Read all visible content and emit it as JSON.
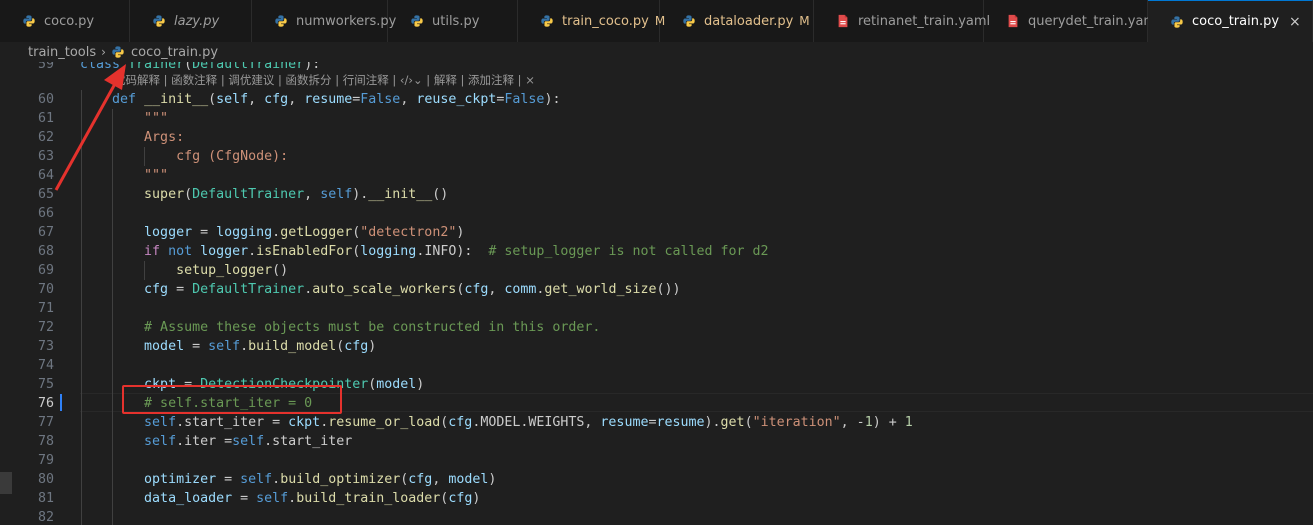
{
  "tabs": [
    {
      "label": "coco.py",
      "icon": "python-icon",
      "italic": false,
      "modified": false,
      "active": false
    },
    {
      "label": "lazy.py",
      "icon": "python-icon",
      "italic": true,
      "modified": false,
      "active": false
    },
    {
      "label": "numworkers.py",
      "icon": "python-icon",
      "italic": false,
      "modified": false,
      "active": false
    },
    {
      "label": "utils.py",
      "icon": "python-icon",
      "italic": false,
      "modified": false,
      "active": false
    },
    {
      "label": "train_coco.py",
      "icon": "python-icon",
      "italic": false,
      "modified": true,
      "active": false
    },
    {
      "label": "dataloader.py",
      "icon": "python-icon",
      "italic": false,
      "modified": true,
      "active": false
    },
    {
      "label": "retinanet_train.yaml",
      "icon": "yaml-icon",
      "italic": false,
      "modified": false,
      "active": false
    },
    {
      "label": "querydet_train.yaml",
      "icon": "yaml-icon",
      "italic": false,
      "modified": false,
      "active": false
    },
    {
      "label": "coco_train.py",
      "icon": "python-icon",
      "italic": false,
      "modified": false,
      "active": true
    }
  ],
  "modified_flag": "M",
  "close_glyph": "×",
  "breadcrumb": {
    "folder": "train_tools",
    "separator": "›",
    "file": "coco_train.py"
  },
  "codelens": "代码解释 | 函数注释 | 调优建议 | 函数拆分 | 行间注释 | ‹/›⌄ | 解释 | 添加注释 | ×",
  "current_line": "76",
  "lines": [
    {
      "n": "59",
      "tokens": [
        [
          "kw",
          "class "
        ],
        [
          "cls",
          "Trainer"
        ],
        [
          "",
          "("
        ],
        [
          "cls",
          "DefaultTrainer"
        ],
        [
          "",
          "):"
        ]
      ]
    },
    {
      "n": "60",
      "tokens": [
        [
          "",
          "    "
        ],
        [
          "kw",
          "def "
        ],
        [
          "fn",
          "__init__"
        ],
        [
          "",
          "("
        ],
        [
          "pr",
          "self"
        ],
        [
          "",
          ", "
        ],
        [
          "pr",
          "cfg"
        ],
        [
          "",
          ", "
        ],
        [
          "pr",
          "resume"
        ],
        [
          "",
          "="
        ],
        [
          "kw",
          "False"
        ],
        [
          "",
          ", "
        ],
        [
          "pr",
          "reuse_ckpt"
        ],
        [
          "",
          "="
        ],
        [
          "kw",
          "False"
        ],
        [
          "",
          "):"
        ]
      ]
    },
    {
      "n": "61",
      "tokens": [
        [
          "",
          "        "
        ],
        [
          "str",
          "\"\"\""
        ]
      ]
    },
    {
      "n": "62",
      "tokens": [
        [
          "",
          "        "
        ],
        [
          "str",
          "Args:"
        ]
      ]
    },
    {
      "n": "63",
      "tokens": [
        [
          "",
          "            "
        ],
        [
          "str",
          "cfg (CfgNode):"
        ]
      ]
    },
    {
      "n": "64",
      "tokens": [
        [
          "",
          "        "
        ],
        [
          "str",
          "\"\"\""
        ]
      ]
    },
    {
      "n": "65",
      "tokens": [
        [
          "",
          "        "
        ],
        [
          "fn",
          "super"
        ],
        [
          "",
          "("
        ],
        [
          "cls",
          "DefaultTrainer"
        ],
        [
          "",
          ", "
        ],
        [
          "kw",
          "self"
        ],
        [
          "",
          ")."
        ],
        [
          "fn",
          "__init__"
        ],
        [
          "",
          "()"
        ]
      ]
    },
    {
      "n": "66",
      "tokens": []
    },
    {
      "n": "67",
      "tokens": [
        [
          "",
          "        "
        ],
        [
          "pr",
          "logger"
        ],
        [
          "",
          " = "
        ],
        [
          "pr",
          "logging"
        ],
        [
          "",
          "."
        ],
        [
          "fn",
          "getLogger"
        ],
        [
          "",
          "("
        ],
        [
          "str",
          "\"detectron2\""
        ],
        [
          "",
          ")"
        ]
      ]
    },
    {
      "n": "68",
      "tokens": [
        [
          "",
          "        "
        ],
        [
          "ctl",
          "if "
        ],
        [
          "kw",
          "not "
        ],
        [
          "pr",
          "logger"
        ],
        [
          "",
          "."
        ],
        [
          "fn",
          "isEnabledFor"
        ],
        [
          "",
          "("
        ],
        [
          "pr",
          "logging"
        ],
        [
          "",
          ".INFO):  "
        ],
        [
          "cmt",
          "# setup_logger is not called for d2"
        ]
      ]
    },
    {
      "n": "69",
      "tokens": [
        [
          "",
          "            "
        ],
        [
          "fn",
          "setup_logger"
        ],
        [
          "",
          "()"
        ]
      ]
    },
    {
      "n": "70",
      "tokens": [
        [
          "",
          "        "
        ],
        [
          "pr",
          "cfg"
        ],
        [
          "",
          " = "
        ],
        [
          "cls",
          "DefaultTrainer"
        ],
        [
          "",
          "."
        ],
        [
          "fn",
          "auto_scale_workers"
        ],
        [
          "",
          "("
        ],
        [
          "pr",
          "cfg"
        ],
        [
          "",
          ", "
        ],
        [
          "pr",
          "comm"
        ],
        [
          "",
          "."
        ],
        [
          "fn",
          "get_world_size"
        ],
        [
          "",
          "())"
        ]
      ]
    },
    {
      "n": "71",
      "tokens": []
    },
    {
      "n": "72",
      "tokens": [
        [
          "",
          "        "
        ],
        [
          "cmt",
          "# Assume these objects must be constructed in this order."
        ]
      ]
    },
    {
      "n": "73",
      "tokens": [
        [
          "",
          "        "
        ],
        [
          "pr",
          "model"
        ],
        [
          "",
          " = "
        ],
        [
          "kw",
          "self"
        ],
        [
          "",
          "."
        ],
        [
          "fn",
          "build_model"
        ],
        [
          "",
          "("
        ],
        [
          "pr",
          "cfg"
        ],
        [
          "",
          ")"
        ]
      ]
    },
    {
      "n": "74",
      "tokens": []
    },
    {
      "n": "75",
      "tokens": [
        [
          "",
          "        "
        ],
        [
          "pr",
          "ckpt"
        ],
        [
          "",
          " = "
        ],
        [
          "cls",
          "DetectionCheckpointer"
        ],
        [
          "",
          "("
        ],
        [
          "pr",
          "model"
        ],
        [
          "",
          ")"
        ]
      ]
    },
    {
      "n": "76",
      "tokens": [
        [
          "",
          "        "
        ],
        [
          "cmt",
          "# self.start_iter = 0"
        ]
      ]
    },
    {
      "n": "77",
      "tokens": [
        [
          "",
          "        "
        ],
        [
          "kw",
          "self"
        ],
        [
          "",
          ".start_iter = "
        ],
        [
          "pr",
          "ckpt"
        ],
        [
          "",
          "."
        ],
        [
          "fn",
          "resume_or_load"
        ],
        [
          "",
          "("
        ],
        [
          "pr",
          "cfg"
        ],
        [
          "",
          ".MODEL.WEIGHTS, "
        ],
        [
          "pr",
          "resume"
        ],
        [
          "",
          "="
        ],
        [
          "pr",
          "resume"
        ],
        [
          "",
          ")."
        ],
        [
          "fn",
          "get"
        ],
        [
          "",
          "("
        ],
        [
          "str",
          "\"iteration\""
        ],
        [
          "",
          ", -"
        ],
        [
          "num",
          "1"
        ],
        [
          "",
          ") + "
        ],
        [
          "num",
          "1"
        ]
      ]
    },
    {
      "n": "78",
      "tokens": [
        [
          "",
          "        "
        ],
        [
          "kw",
          "self"
        ],
        [
          "",
          ".iter ="
        ],
        [
          "kw",
          "self"
        ],
        [
          "",
          ".start_iter"
        ]
      ]
    },
    {
      "n": "79",
      "tokens": []
    },
    {
      "n": "80",
      "tokens": [
        [
          "",
          "        "
        ],
        [
          "pr",
          "optimizer"
        ],
        [
          "",
          " = "
        ],
        [
          "kw",
          "self"
        ],
        [
          "",
          "."
        ],
        [
          "fn",
          "build_optimizer"
        ],
        [
          "",
          "("
        ],
        [
          "pr",
          "cfg"
        ],
        [
          "",
          ", "
        ],
        [
          "pr",
          "model"
        ],
        [
          "",
          ")"
        ]
      ]
    },
    {
      "n": "81",
      "tokens": [
        [
          "",
          "        "
        ],
        [
          "pr",
          "data_loader"
        ],
        [
          "",
          " = "
        ],
        [
          "kw",
          "self"
        ],
        [
          "",
          "."
        ],
        [
          "fn",
          "build_train_loader"
        ],
        [
          "",
          "("
        ],
        [
          "pr",
          "cfg"
        ],
        [
          "",
          ")"
        ]
      ]
    },
    {
      "n": "82",
      "tokens": []
    }
  ],
  "colors": {
    "accent": "#0078d4",
    "annotation_red": "#e5322d",
    "python_icon_blue": "#3572a5",
    "python_icon_yellow": "#f7c948",
    "yaml_icon": "#e04b4b"
  }
}
